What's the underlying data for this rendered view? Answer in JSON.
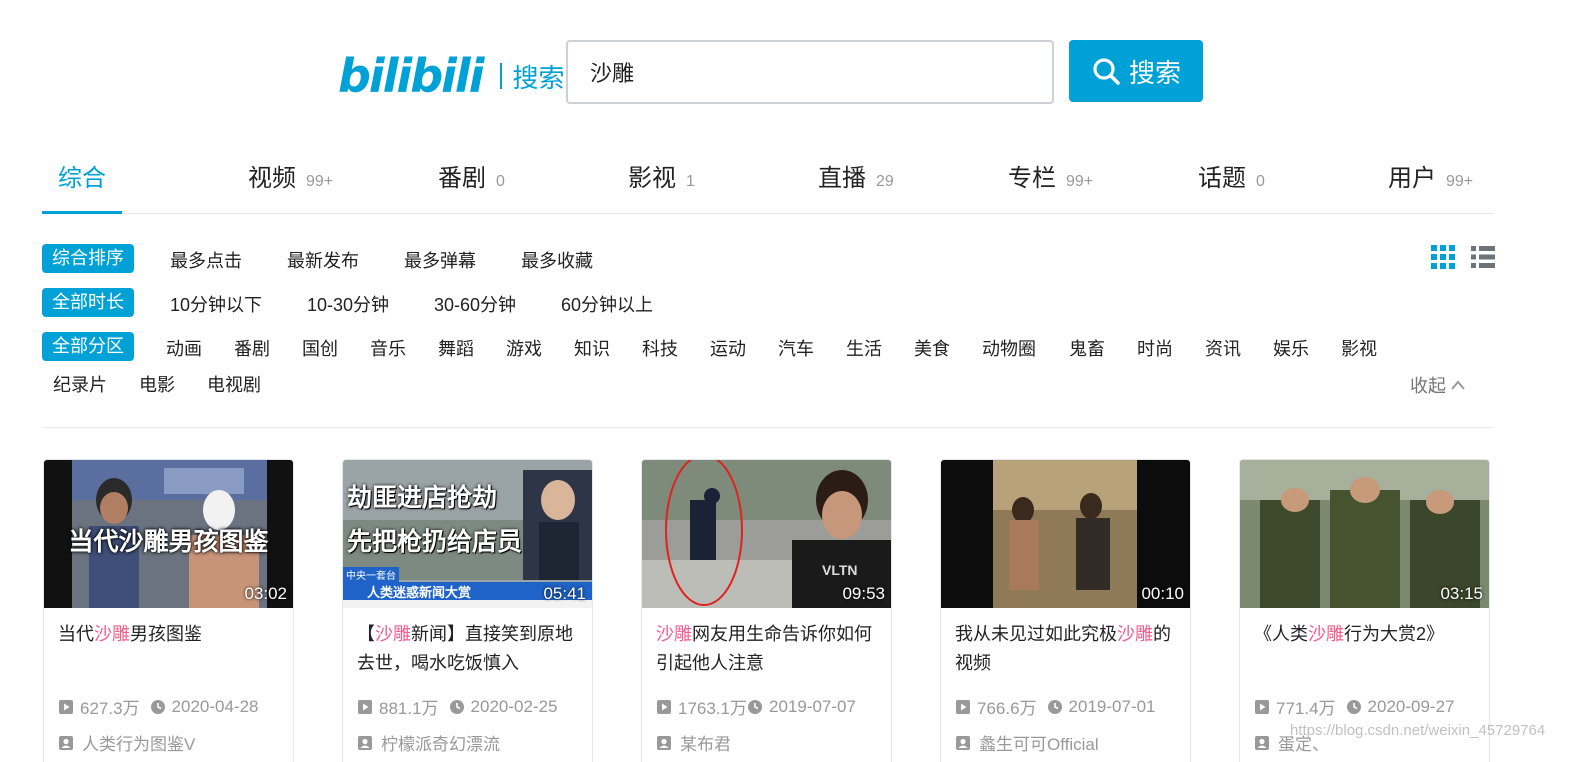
{
  "header": {
    "logo_text": "bilibili",
    "logo_sub": "搜索",
    "search_value": "沙雕",
    "search_button": "搜索"
  },
  "nav": {
    "tabs": [
      {
        "label": "综合",
        "count": ""
      },
      {
        "label": "视频",
        "count": "99+"
      },
      {
        "label": "番剧",
        "count": "0"
      },
      {
        "label": "影视",
        "count": "1"
      },
      {
        "label": "直播",
        "count": "29"
      },
      {
        "label": "专栏",
        "count": "99+"
      },
      {
        "label": "话题",
        "count": "0"
      },
      {
        "label": "用户",
        "count": "99+"
      }
    ]
  },
  "filters": {
    "sort": {
      "active": "综合排序",
      "options": [
        "最多点击",
        "最新发布",
        "最多弹幕",
        "最多收藏"
      ]
    },
    "duration": {
      "active": "全部时长",
      "options": [
        "10分钟以下",
        "10-30分钟",
        "30-60分钟",
        "60分钟以上"
      ]
    },
    "zone": {
      "active": "全部分区",
      "options": [
        "动画",
        "番剧",
        "国创",
        "音乐",
        "舞蹈",
        "游戏",
        "知识",
        "科技",
        "运动",
        "汽车",
        "生活",
        "美食",
        "动物圈",
        "鬼畜",
        "时尚",
        "资讯",
        "娱乐",
        "影视"
      ],
      "options2": [
        "纪录片",
        "电影",
        "电视剧"
      ]
    },
    "collapse": "收起"
  },
  "videos": [
    {
      "duration": "03:02",
      "thumb_text": "当代沙雕男孩图鉴",
      "title_pre": "当代",
      "title_kw": "沙雕",
      "title_post": "男孩图鉴",
      "views": "627.3万",
      "date": "2020-04-28",
      "up": "人类行为图鉴V"
    },
    {
      "duration": "05:41",
      "thumb_text1": "劫匪进店抢劫",
      "thumb_text2": "先把枪扔给店员",
      "thumb_banner": "人类迷惑新闻大赏",
      "thumb_small": "中央一套台",
      "title_pre": "【",
      "title_kw": "沙雕",
      "title_post": "新闻】直接笑到原地去世，喝水吃饭慎入",
      "views": "881.1万",
      "date": "2020-02-25",
      "up": "柠檬派奇幻漂流"
    },
    {
      "duration": "09:53",
      "thumb_shirt": "VLTN",
      "title_pre": "",
      "title_kw": "沙雕",
      "title_post": "网友用生命告诉你如何引起他人注意",
      "views": "1763.1万",
      "date": "2019-07-07",
      "up": "某布君"
    },
    {
      "duration": "00:10",
      "title_pre": "我从未见过如此究极",
      "title_kw": "沙雕",
      "title_post": "的视频",
      "views": "766.6万",
      "date": "2019-07-01",
      "up": "蠡生可可Official"
    },
    {
      "duration": "03:15",
      "title_pre": "《人类",
      "title_kw": "沙雕",
      "title_post": "行为大赏2》",
      "views": "771.4万",
      "date": "2020-09-27",
      "up": "蛋定、"
    }
  ],
  "watermark": "https://blog.csdn.net/weixin_45729764",
  "colors": {
    "accent": "#00a1d6",
    "keyword": "#f25d8e"
  }
}
